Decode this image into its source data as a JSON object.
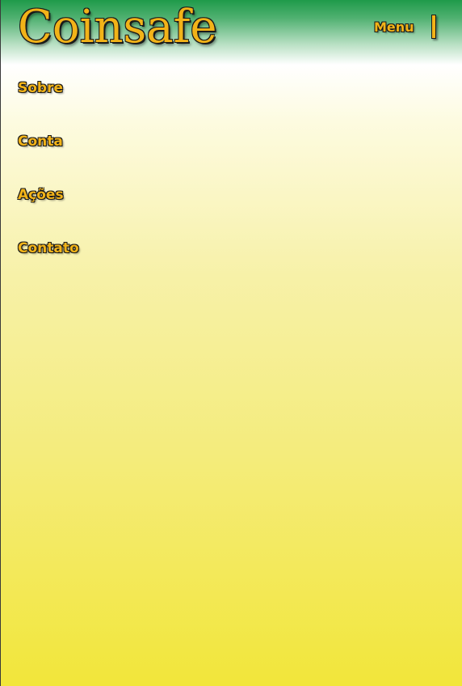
{
  "header": {
    "brand": "Coinsafe",
    "menu_label": "Menu"
  },
  "nav": {
    "items": [
      {
        "label": "Sobre"
      },
      {
        "label": "Conta"
      },
      {
        "label": "Ações"
      },
      {
        "label": "Contato"
      }
    ]
  },
  "colors": {
    "accent": "#f2b318",
    "header_green": "#1f9a4a",
    "background_yellow": "#f2e63a",
    "outline": "#1a1a1a"
  }
}
